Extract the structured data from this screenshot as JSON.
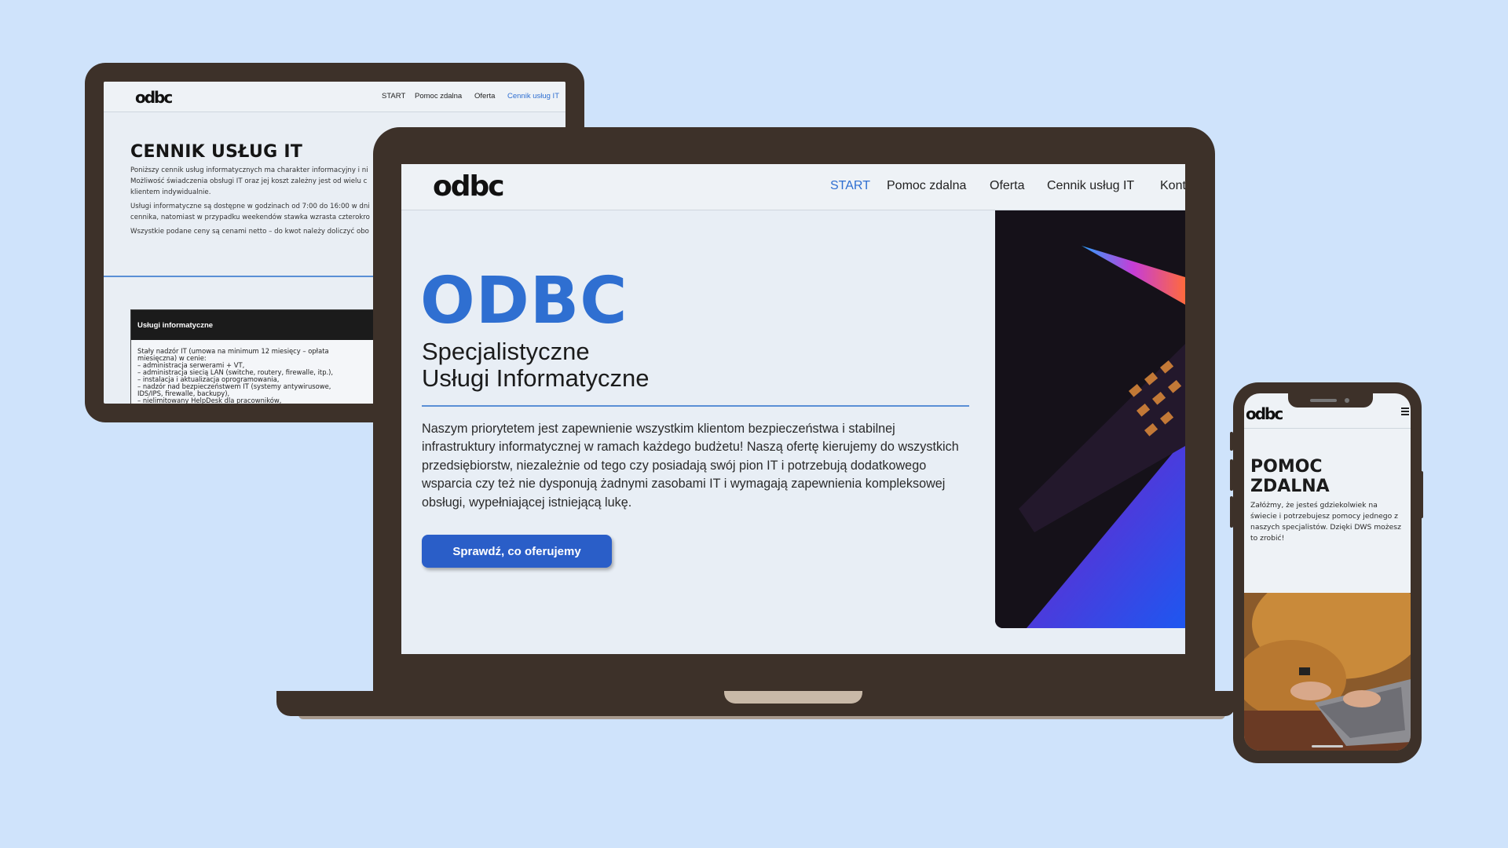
{
  "colors": {
    "background": "#cfe3fb",
    "device": "#3d3129",
    "accent": "#2f6fd1",
    "button": "#2a5ec8"
  },
  "tablet": {
    "logo": "odbc",
    "nav": [
      "START",
      "Pomoc zdalna",
      "Oferta",
      "Cennik usług IT"
    ],
    "active_nav": "Cennik usług IT",
    "title": "CENNIK USŁUG IT",
    "para1_line1": "Poniższy cennik usług informatycznych ma charakter informacyjny i ni",
    "para1_line2": "Możliwość świadczenia obsługi IT oraz jej koszt zależny jest od wielu c",
    "para1_line3": "klientem indywidualnie.",
    "para2_line1": "Usługi informatyczne są dostępne w godzinach od 7:00 do 16:00 w dni",
    "para2_line2": "cennika, natomiast w przypadku weekendów stawka wzrasta czterokro",
    "para3": "Wszystkie podane ceny są cenami netto – do kwot należy doliczyć obo",
    "card_title": "Usługi informatyczne",
    "card_lines": [
      "Stały nadzór IT (umowa na minimum 12 miesięcy – opłata",
      "miesięczna) w cenie:",
      "– administracja serwerami + VT,",
      "– administracja siecią LAN (switche, routery, firewalle, itp.),",
      "– instalacja i aktualizacja oprogramowania,",
      "– nadzór nad bezpieczeństwem IT (systemy antywirusowe,",
      "IDS/IPS, firewalle, backupy),",
      "– nielimitowany HelpDesk dla pracowników,"
    ]
  },
  "laptop": {
    "logo": "odbc",
    "nav": [
      "START",
      "Pomoc zdalna",
      "Oferta",
      "Cennik usług IT",
      "Kont"
    ],
    "active_nav": "START",
    "title": "ODBC",
    "subtitle_line1": "Specjalistyczne",
    "subtitle_line2": "Usługi Informatyczne",
    "description": "Naszym priorytetem jest zapewnienie wszystkim klientom bezpieczeństwa i stabilnej infrastruktury informatycznej w ramach każdego budżetu! Naszą ofertę kierujemy do wszystkich przedsiębiorstw, niezależnie od tego czy posiadają swój pion IT i potrzebują dodatkowego wsparcia czy też nie dysponują żadnymi zasobami IT i wymagają zapewnienia kompleksowej obsługi, wypełniającej istniejącą lukę.",
    "cta_label": "Sprawdź, co oferujemy",
    "photo_icon": "laptop-keyboard-photo"
  },
  "phone": {
    "logo": "odbc",
    "menu_icon": "hamburger-icon",
    "title_line1": "POMOC",
    "title_line2": "ZDALNA",
    "description": "Załóżmy, że jesteś gdziekolwiek na świecie i potrzebujesz pomocy jednego z naszych specjalistów. Dzięki DWS możesz to zrobić!",
    "photo_icon": "person-typing-photo"
  }
}
